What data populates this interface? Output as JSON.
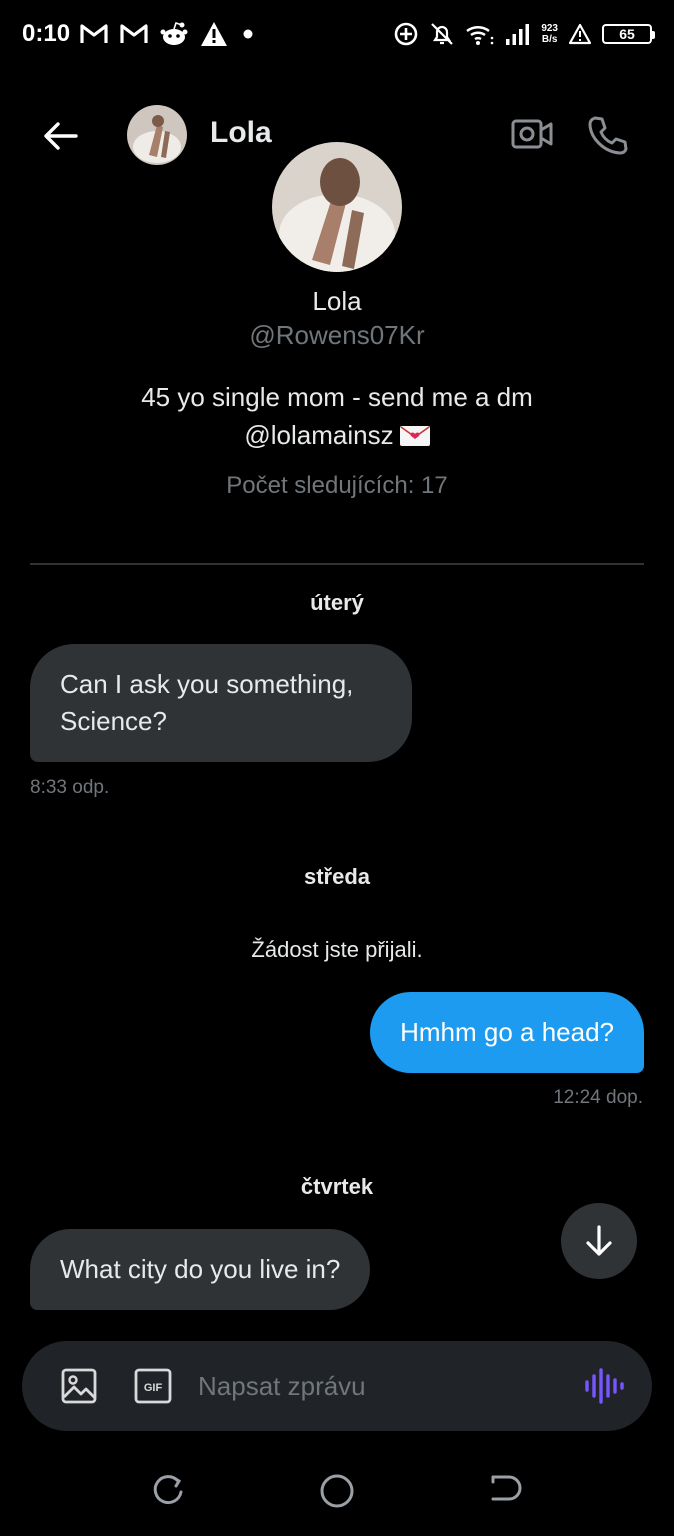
{
  "status_bar": {
    "time": "0:10",
    "net_speed_value": "923",
    "net_speed_unit": "B/s",
    "battery": "65",
    "left_icons": [
      "gmail-icon",
      "gmail-icon",
      "reddit-icon",
      "warning-icon",
      "dot-icon"
    ],
    "right_icons": [
      "data-saver-icon",
      "bell-off-icon",
      "wifi-icon",
      "signal-icon",
      "alert-icon",
      "battery-icon"
    ]
  },
  "header": {
    "name": "Lola",
    "icons": [
      "back-arrow-icon",
      "video-call-icon",
      "phone-icon"
    ]
  },
  "profile": {
    "name": "Lola",
    "handle": "@Rowens07Kr",
    "bio_line1": "45 yo single mom -  send me a dm",
    "bio_line2": "@lolamainsz",
    "followers": "Počet sledujících: 17"
  },
  "conversation": {
    "day1": "úterý",
    "msg1_line1": "Can I ask you something,",
    "msg1_line2": "Science?",
    "msg1_time": "8:33 odp.",
    "day2": "středa",
    "system_msg": "Žádost jste přijali.",
    "msg2": "Hmhm go a head?",
    "msg2_time": "12:24 dop.",
    "day3": "čtvrtek",
    "msg3": "What city do you live in?"
  },
  "composer": {
    "placeholder": "Napsat zprávu",
    "gif_label": "GIF"
  },
  "colors": {
    "background": "#000000",
    "received_bubble": "#2f3336",
    "sent_bubble": "#1d9bf0",
    "muted_text": "#71767b",
    "voice_accent": "#7856ff"
  }
}
